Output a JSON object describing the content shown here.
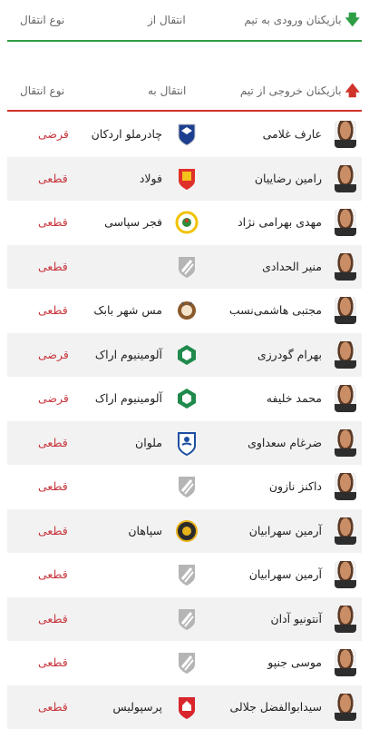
{
  "incoming": {
    "title": "بازیکنان ورودی به تیم",
    "col_from": "انتقال از",
    "col_type": "نوع انتقال",
    "icon": "arrow-down-icon",
    "accent": "#2e9e44"
  },
  "outgoing": {
    "title": "بازیکنان خروجی از تیم",
    "col_to": "انتقال به",
    "col_type": "نوع انتقال",
    "icon": "arrow-up-icon",
    "accent": "#d0332b"
  },
  "rows": [
    {
      "player": "عارف غلامی",
      "club": "چادرملو اردکان",
      "logo": "chadormalu-logo",
      "type": "قرضی"
    },
    {
      "player": "رامین رضاییان",
      "club": "فولاد",
      "logo": "foolad-logo",
      "type": "قطعی"
    },
    {
      "player": "مهدی بهرامی نژاد",
      "club": "فجر سپاسی",
      "logo": "fajr-sepasi-logo",
      "type": "قطعی"
    },
    {
      "player": "منیر الحدادی",
      "club": "",
      "logo": "placeholder-shield-icon",
      "type": "قطعی"
    },
    {
      "player": "مجتبی هاشمی‌نسب",
      "club": "مس شهر بابک",
      "logo": "mes-shahr-babak-logo",
      "type": "قطعی"
    },
    {
      "player": "بهرام گودرزی",
      "club": "آلومینیوم اراک",
      "logo": "aluminium-arak-logo",
      "type": "قرضی"
    },
    {
      "player": "محمد خلیفه",
      "club": "آلومینیوم اراک",
      "logo": "aluminium-arak-logo",
      "type": "قرضی"
    },
    {
      "player": "ضرغام سعداوی",
      "club": "ملوان",
      "logo": "malavan-logo",
      "type": "قطعی"
    },
    {
      "player": "داکنز نازون",
      "club": "",
      "logo": "placeholder-shield-icon",
      "type": "قطعی"
    },
    {
      "player": "آرمین سهرابیان",
      "club": "سپاهان",
      "logo": "sepahan-logo",
      "type": "قطعی"
    },
    {
      "player": "آرمین سهرابیان",
      "club": "",
      "logo": "placeholder-shield-icon",
      "type": "قطعی"
    },
    {
      "player": "آنتونیو آدان",
      "club": "",
      "logo": "placeholder-shield-icon",
      "type": "قطعی"
    },
    {
      "player": "موسی جنپو",
      "club": "",
      "logo": "placeholder-shield-icon",
      "type": "قطعی"
    },
    {
      "player": "سیدابوالفضل جلالی",
      "club": "پرسپولیس",
      "logo": "persepolis-logo",
      "type": "قطعی"
    }
  ]
}
